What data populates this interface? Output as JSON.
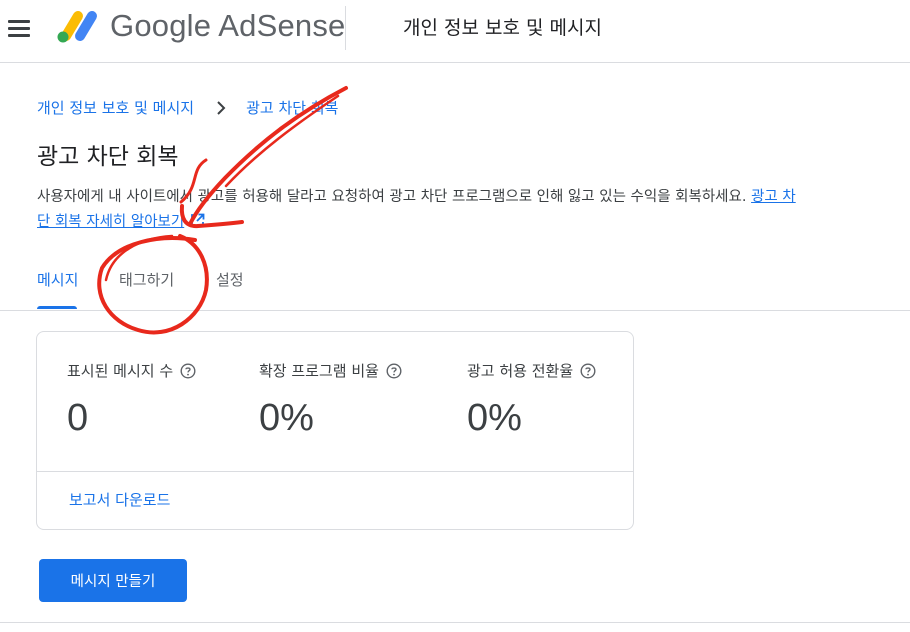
{
  "header": {
    "menu_icon": "hamburger-menu-icon",
    "brand": "Google AdSense",
    "logo_colors": [
      "#fbbc04",
      "#34a853",
      "#4285f4"
    ],
    "title": "개인 정보 보호 및 메시지"
  },
  "breadcrumb": {
    "parent": "개인 정보 보호 및 메시지",
    "separator_icon": "chevron-right-icon",
    "current": "광고 차단 회복"
  },
  "page": {
    "title": "광고 차단 회복",
    "description": "사용자에게 내 사이트에서 광고를 허용해 달라고 요청하여 광고 차단 프로그램으로 인해 잃고 있는 수익을 회복하세요.",
    "learn_more_link": "광고 차단 회복 자세히 알아보기",
    "learn_more_icon": "open-in-new-icon"
  },
  "tabs": [
    {
      "label": "메시지",
      "active": true
    },
    {
      "label": "태그하기",
      "active": false
    },
    {
      "label": "설정",
      "active": false
    }
  ],
  "stats_card": {
    "stats": [
      {
        "label": "표시된 메시지 수",
        "value": "0",
        "icon": "help-icon"
      },
      {
        "label": "확장 프로그램 비율",
        "value": "0%",
        "icon": "help-icon"
      },
      {
        "label": "광고 허용 전환율",
        "value": "0%",
        "icon": "help-icon"
      }
    ],
    "download_link": "보고서 다운로드"
  },
  "primary_button": "메시지 만들기",
  "colors": {
    "accent": "#1a73e8",
    "text": "#202124",
    "muted": "#5f6368",
    "divider": "#dadce0",
    "annotation": "#e8291c"
  }
}
